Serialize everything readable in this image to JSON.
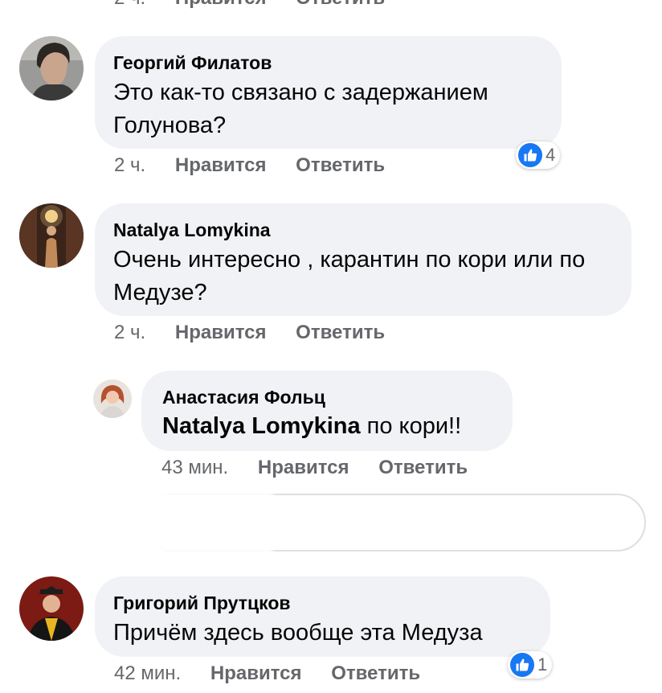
{
  "colors": {
    "bubble": "#f0f2f5",
    "muted": "#65676b",
    "like_blue": "#1877f2"
  },
  "top_cut": {
    "time": "2 ч.",
    "like": "Нравится",
    "reply": "Ответить"
  },
  "comments": [
    {
      "author": "Георгий Филатов",
      "text": "Это как-то связано с задержанием Голунова?",
      "time": "2 ч.",
      "like": "Нравится",
      "reply": "Ответить",
      "reactions": {
        "icon": "like-icon",
        "count": "4"
      }
    },
    {
      "author": "Natalya Lomykina",
      "text": "Очень интересно , карантин по кори или по Медузе?",
      "time": "2 ч.",
      "like": "Нравится",
      "reply": "Ответить"
    },
    {
      "author": "Анастасия Фольц",
      "mention": "Natalya Lomykina",
      "text": " по кори!!",
      "time": "43 мин.",
      "like": "Нравится",
      "reply": "Ответить"
    },
    {
      "author": "Григорий Прутцков",
      "text": "Причём здесь вообще эта Медуза",
      "time": "42 мин.",
      "like": "Нравится",
      "reply": "Ответить",
      "reactions": {
        "icon": "like-icon",
        "count": "1"
      }
    }
  ]
}
